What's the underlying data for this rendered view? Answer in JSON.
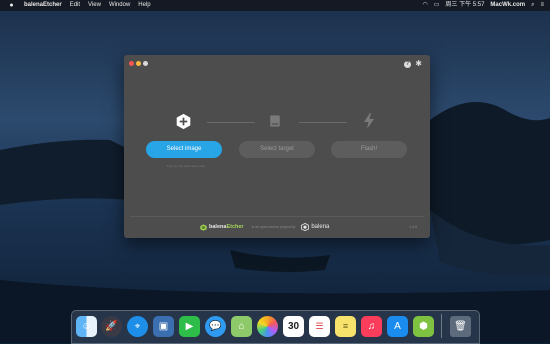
{
  "menubar": {
    "apple_icon": "apple-icon",
    "app_name": "balenaEtcher",
    "menus": [
      "Edit",
      "View",
      "Window",
      "Help"
    ],
    "clock": "周三 下午 5:57",
    "site": "MacWk.com"
  },
  "window": {
    "steps": {
      "select_image_label": "Select image",
      "select_target_label": "Select target",
      "flash_label": "Flash!"
    },
    "hint": "img, iso, zip, and many more",
    "footer": {
      "brand_prefix": "balena",
      "brand_suffix": "Etcher",
      "tagline": "is an open source project by",
      "balena": "balena",
      "version": "1.4.8"
    }
  },
  "colors": {
    "accent": "#28a5e6",
    "window_bg": "#4d4d4d",
    "brand_green": "#a6d65c"
  },
  "dock": {
    "icons": [
      "finder-icon",
      "launchpad-icon",
      "safari-icon",
      "photo-icon",
      "facetime-icon",
      "messages-icon",
      "maps-icon",
      "photos-icon",
      "calendar-icon",
      "reminders-icon",
      "notes-icon",
      "music-icon",
      "app-store-icon",
      "etcher-icon",
      "trash-icon"
    ],
    "calendar_day": "30"
  }
}
